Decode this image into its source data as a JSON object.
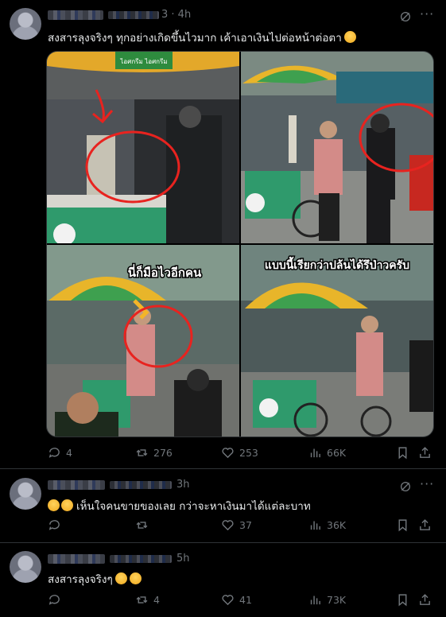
{
  "posts": [
    {
      "time": "3 · 4h",
      "text": "สงสารลุงจริงๆ ทุกอย่างเกิดขึ้นไวมาก เค้าเอาเงินไปต่อหน้าต่อตา",
      "stats": {
        "replies": "4",
        "reposts": "276",
        "likes": "253",
        "views": "66K"
      },
      "media": {
        "umbrella_text": "ไอศกรีม ไอศกรีม",
        "caption_bottom_left": "นี่ก็มือไวอีกคน",
        "caption_bottom_right": "แบบนี้เรียกว่าปล้นได้รึป่าวครับ"
      }
    },
    {
      "time": "3h",
      "text": "เห็นใจคนขายของเลย กว่าจะหาเงินมาได้แต่ละบาท",
      "stats": {
        "replies": "",
        "reposts": "",
        "likes": "37",
        "views": "36K"
      }
    },
    {
      "time": "5h",
      "text": "สงสารลุงจริงๆ",
      "stats": {
        "replies": "",
        "reposts": "4",
        "likes": "41",
        "views": "73K"
      }
    }
  ],
  "colors": {
    "background": "#000000",
    "text": "#e7e9ea",
    "muted": "#71767b",
    "divider": "#2f3336",
    "annotation": "#e8231f"
  }
}
